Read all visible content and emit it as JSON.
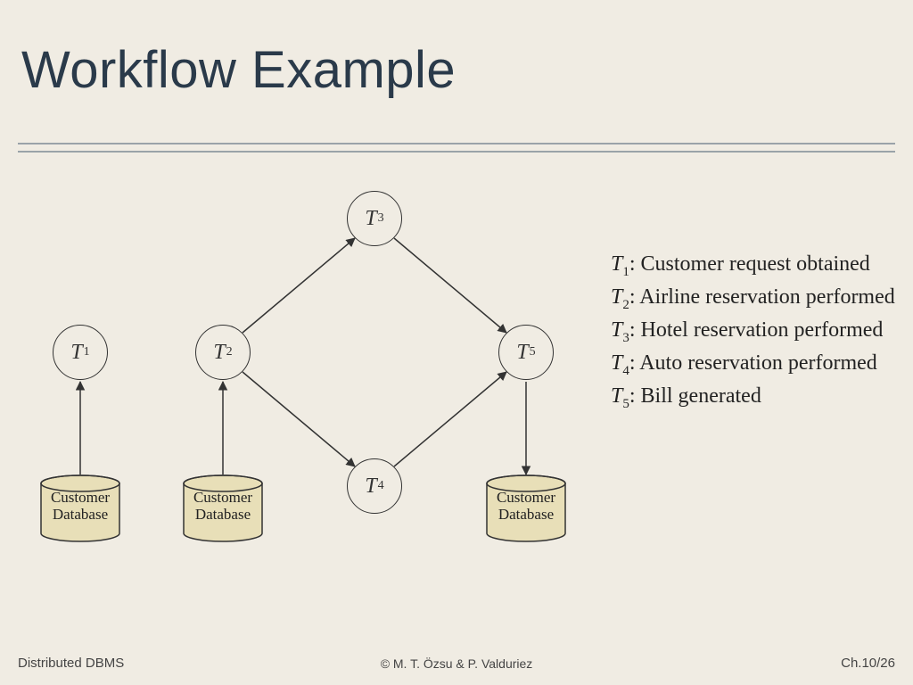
{
  "title": "Workflow Example",
  "nodes": {
    "t1": "T",
    "t1_sub": "1",
    "t2": "T",
    "t2_sub": "2",
    "t3": "T",
    "t3_sub": "3",
    "t4": "T",
    "t4_sub": "4",
    "t5": "T",
    "t5_sub": "5"
  },
  "db_label_line1": "Customer",
  "db_label_line2": "Database",
  "legend": {
    "t1": "Customer request obtained",
    "t2": "Airline reservation performed",
    "t3": "Hotel reservation performed",
    "t4": "Auto reservation performed",
    "t5": "Bill generated"
  },
  "footer": {
    "left": "Distributed DBMS",
    "center": "© M. T. Özsu & P. Valduriez",
    "right": "Ch.10/26"
  },
  "chart_data": {
    "type": "diagram",
    "title": "Workflow Example",
    "nodes": [
      {
        "id": "T1",
        "label": "T1",
        "desc": "Customer request obtained",
        "has_db": true
      },
      {
        "id": "T2",
        "label": "T2",
        "desc": "Airline reservation performed",
        "has_db": true
      },
      {
        "id": "T3",
        "label": "T3",
        "desc": "Hotel reservation performed",
        "has_db": false
      },
      {
        "id": "T4",
        "label": "T4",
        "desc": "Auto reservation performed",
        "has_db": false
      },
      {
        "id": "T5",
        "label": "T5",
        "desc": "Bill generated",
        "has_db": true
      }
    ],
    "edges": [
      {
        "from": "DB1",
        "to": "T1"
      },
      {
        "from": "DB2",
        "to": "T2"
      },
      {
        "from": "T2",
        "to": "T3"
      },
      {
        "from": "T2",
        "to": "T4"
      },
      {
        "from": "T3",
        "to": "T5"
      },
      {
        "from": "T4",
        "to": "T5"
      },
      {
        "from": "T5",
        "to": "DB3"
      }
    ],
    "databases": [
      {
        "id": "DB1",
        "label": "Customer Database",
        "under": "T1"
      },
      {
        "id": "DB2",
        "label": "Customer Database",
        "under": "T2"
      },
      {
        "id": "DB3",
        "label": "Customer Database",
        "under": "T5"
      }
    ]
  }
}
